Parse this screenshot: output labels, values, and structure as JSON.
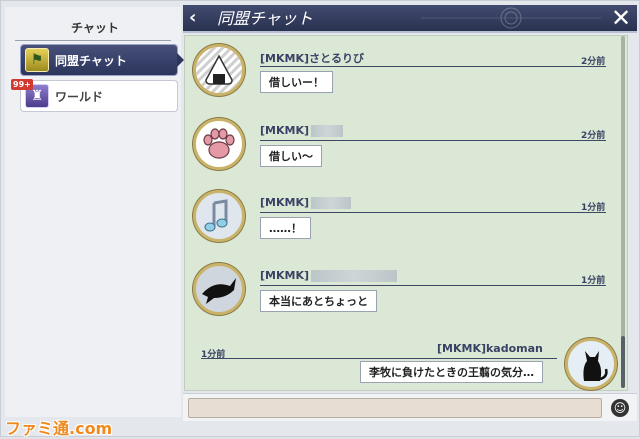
{
  "sidebar": {
    "title": "チャット",
    "items": [
      {
        "label": "同盟チャット",
        "icon": "alliance-flag-icon",
        "active": true
      },
      {
        "label": "ワールド",
        "icon": "world-crest-icon",
        "badge": "99+"
      }
    ]
  },
  "header": {
    "title": "同盟チャット",
    "back_icon": "back-chevron-icon",
    "close_icon": "close-x-icon"
  },
  "messages": [
    {
      "sender": "[MKMK]さとるりび",
      "time": "2分前",
      "text": "借しいー！",
      "avatar": "onigiri-avatar"
    },
    {
      "sender": "[MKMK]",
      "time": "2分前",
      "text": "借しい〜",
      "avatar": "paw-avatar"
    },
    {
      "sender": "[MKMK]",
      "time": "1分前",
      "text": "‥‥‥！",
      "avatar": "music-note-avatar"
    },
    {
      "sender": "[MKMK]",
      "time": "1分前",
      "text": "本当にあとちょっと",
      "avatar": "shark-avatar"
    },
    {
      "sender": "[MKMK]kadoman",
      "time": "1分前",
      "text": "李牧に負けたときの王翦の気分…",
      "avatar": "cat-avatar",
      "own": true
    }
  ],
  "input": {
    "placeholder": "",
    "emoji_icon": "smile-icon"
  },
  "watermark": "ファミ通.com",
  "colors": {
    "header": "#2a3251",
    "chat_bg": "#dbe8d5",
    "avatar_ring": "#c9b36a"
  }
}
